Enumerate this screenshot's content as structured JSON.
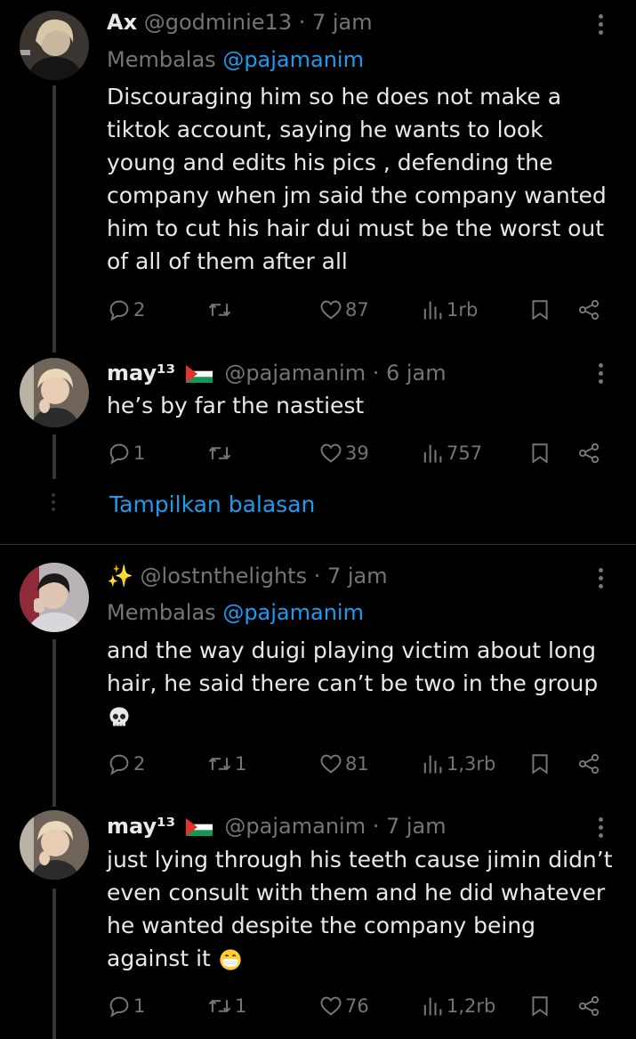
{
  "tweets": [
    {
      "name": "Ax",
      "handle": "@godminie13",
      "time": "· 7 jam",
      "reply_prefix": "Membalas ",
      "reply_to": "@pajamanim",
      "text": "Discouraging him so he does not make a tiktok account, saying he wants to look young and edits his pics , defending the company when jm said the company wanted him to cut his hair dui must be the worst out of all of them after all",
      "replies": "2",
      "retweets": "",
      "likes": "87",
      "views": "1rb"
    },
    {
      "name": "may¹³",
      "handle": "@pajamanim",
      "time": "· 6 jam",
      "text": "he’s by far the nastiest",
      "replies": "1",
      "retweets": "",
      "likes": "39",
      "views": "757"
    },
    {
      "name": "✨",
      "handle": "@lostnthelights",
      "time": "· 7 jam",
      "reply_prefix": "Membalas ",
      "reply_to": "@pajamanim",
      "text": "and the way duigi playing victim about long hair, he said there can’t be two in the group",
      "text_emoji": "skull-emoji",
      "replies": "2",
      "retweets": "1",
      "likes": "81",
      "views": "1,3rb"
    },
    {
      "name": "may¹³",
      "handle": "@pajamanim",
      "time": "· 7 jam",
      "text": "just lying through his teeth cause jimin didn’t even consult with them and he did whatever he wanted despite the company being against it",
      "text_emoji": "mask-face-emoji",
      "replies": "1",
      "retweets": "1",
      "likes": "76",
      "views": "1,2rb"
    }
  ],
  "show_replies_label": "Tampilkan balasan",
  "colors": {
    "background": "#000000",
    "text": "#e7e9ea",
    "muted": "#71767b",
    "accent": "#1d9bf0",
    "line": "#333639"
  }
}
